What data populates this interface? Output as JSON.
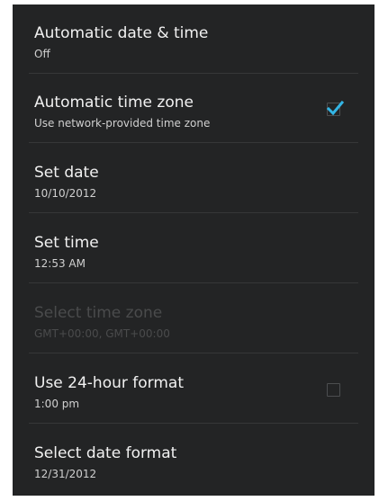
{
  "settings": [
    {
      "title": "Automatic date & time",
      "summary": "Off"
    },
    {
      "title": "Automatic time zone",
      "summary": "Use network-provided time zone",
      "checked": true
    },
    {
      "title": "Set date",
      "summary": "10/10/2012"
    },
    {
      "title": "Set time",
      "summary": "12:53 AM"
    },
    {
      "title": "Select time zone",
      "summary": "GMT+00:00, GMT+00:00",
      "disabled": true
    },
    {
      "title": "Use 24-hour format",
      "summary": "1:00 pm",
      "checked": false
    },
    {
      "title": "Select date format",
      "summary": "12/31/2012"
    }
  ],
  "colors": {
    "background": "#232425",
    "title": "#f1f1f1",
    "summary": "#d0d0d0",
    "disabled_text": "#4a4b4c",
    "checkmark": "#33b5e5",
    "divider": "#363738"
  }
}
